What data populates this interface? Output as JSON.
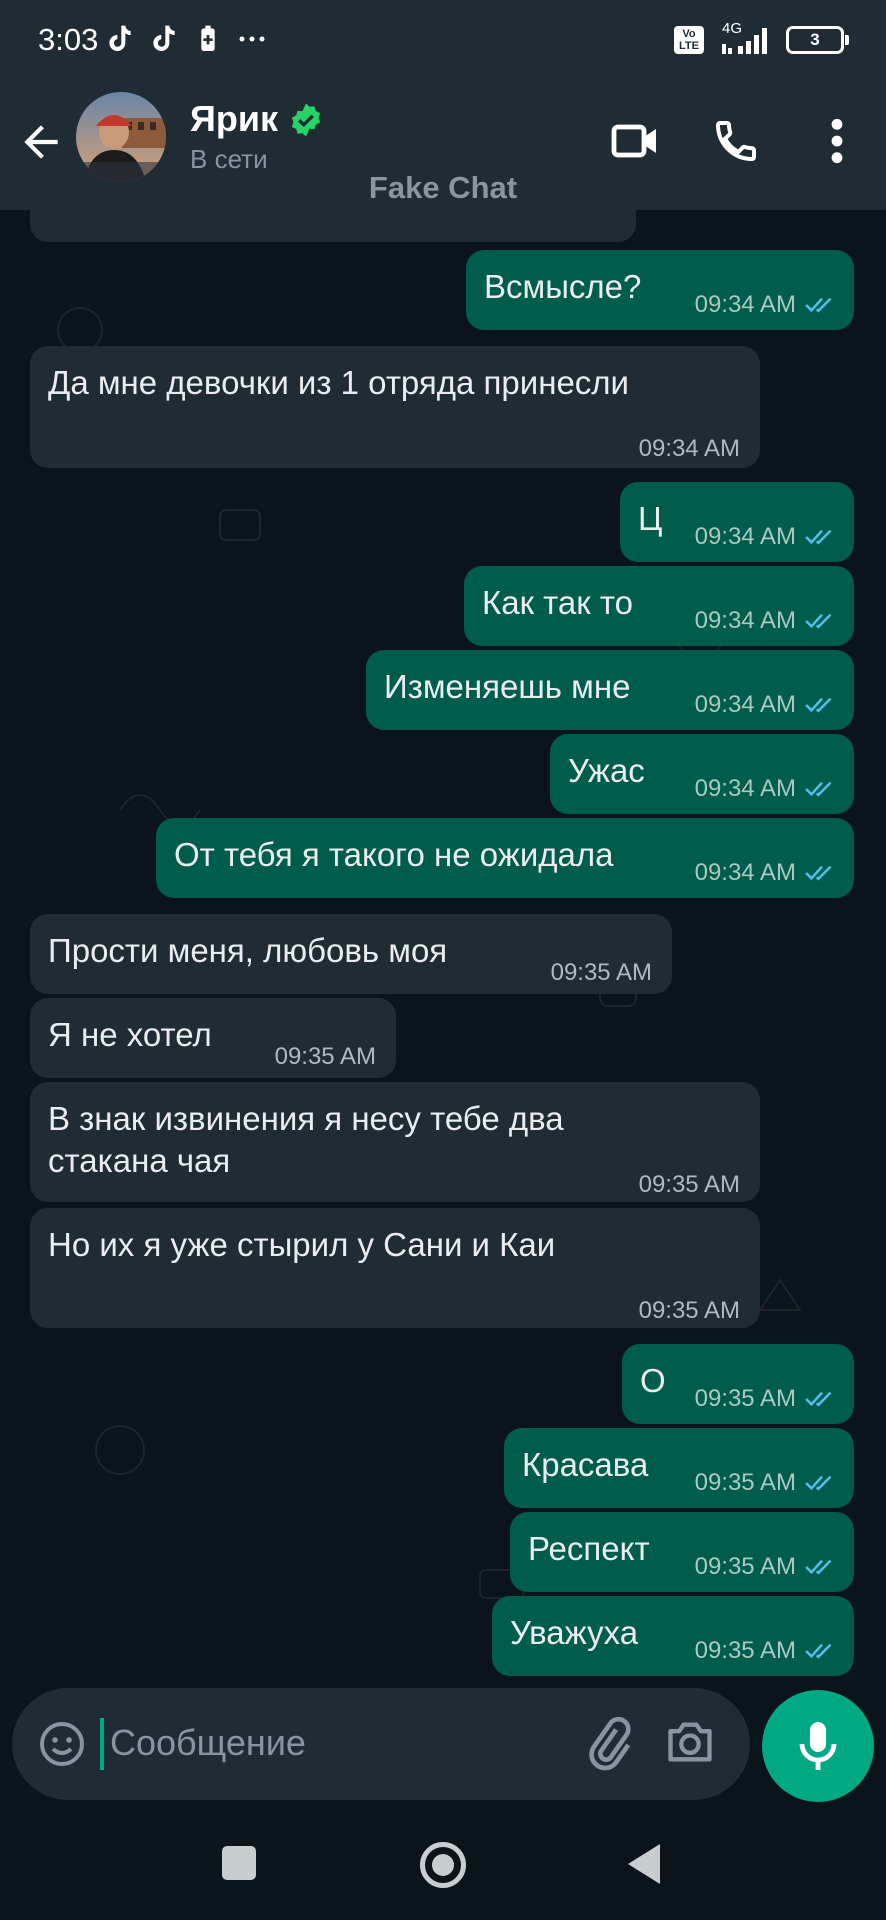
{
  "status_bar": {
    "time": "3:03",
    "network": "4G",
    "volte": "Vo LTE",
    "battery": "3"
  },
  "header": {
    "contact_name": "Ярик",
    "contact_status": "В сети",
    "watermark": "Fake Chat"
  },
  "messages": [
    {
      "dir": "out",
      "text": "Всмысле?",
      "time": "09:34 AM"
    },
    {
      "dir": "in",
      "text": "Да мне девочки из 1 отряда принесли",
      "time": "09:34 AM"
    },
    {
      "dir": "out",
      "text": "Ц",
      "time": "09:34 AM"
    },
    {
      "dir": "out",
      "text": "Как так то",
      "time": "09:34 AM"
    },
    {
      "dir": "out",
      "text": "Изменяешь мне",
      "time": "09:34 AM"
    },
    {
      "dir": "out",
      "text": "Ужас",
      "time": "09:34 AM"
    },
    {
      "dir": "out",
      "text": "От тебя я такого не ожидала",
      "time": "09:34 AM"
    },
    {
      "dir": "in",
      "text": "Прости меня, любовь моя",
      "time": "09:35 AM"
    },
    {
      "dir": "in",
      "text": "Я не хотел",
      "time": "09:35 AM"
    },
    {
      "dir": "in",
      "text": "В знак извинения я несу тебе два\nстакана чая",
      "time": "09:35 AM"
    },
    {
      "dir": "in",
      "text": "Но их я уже стырил у Сани и Каи",
      "time": "09:35 AM"
    },
    {
      "dir": "out",
      "text": "О",
      "time": "09:35 AM"
    },
    {
      "dir": "out",
      "text": "Красава",
      "time": "09:35 AM"
    },
    {
      "dir": "out",
      "text": "Респект",
      "time": "09:35 AM"
    },
    {
      "dir": "out",
      "text": "Уважуха",
      "time": "09:35 AM"
    }
  ],
  "composer": {
    "placeholder": "Сообщение"
  },
  "colors": {
    "outgoing_bubble": "#005c4b",
    "incoming_bubble": "#202c33",
    "accent": "#00a884",
    "read_ticks": "#53bdeb",
    "header": "#1f2c34",
    "background": "#0b141a"
  },
  "icons": [
    "back-arrow-icon",
    "verified-icon",
    "video-call-icon",
    "phone-icon",
    "more-options-icon",
    "emoji-icon",
    "attach-icon",
    "camera-icon",
    "mic-icon"
  ]
}
